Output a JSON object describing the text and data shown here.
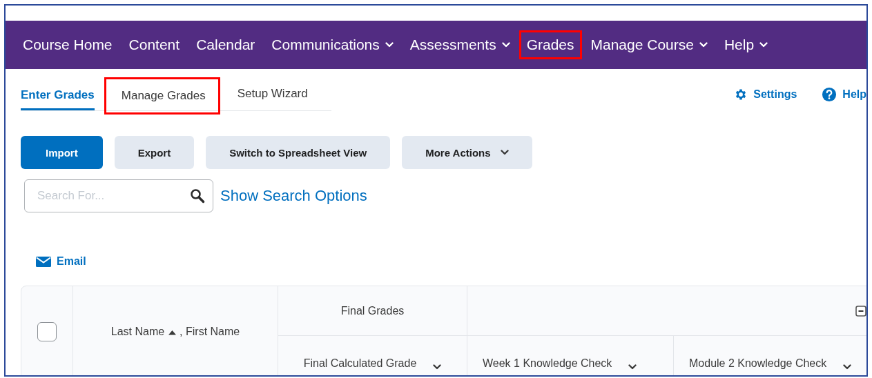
{
  "nav": {
    "items": [
      {
        "label": "Course Home",
        "dropdown": false,
        "highlighted": false
      },
      {
        "label": "Content",
        "dropdown": false,
        "highlighted": false
      },
      {
        "label": "Calendar",
        "dropdown": false,
        "highlighted": false
      },
      {
        "label": "Communications",
        "dropdown": true,
        "highlighted": false
      },
      {
        "label": "Assessments",
        "dropdown": true,
        "highlighted": false
      },
      {
        "label": "Grades",
        "dropdown": false,
        "highlighted": true
      },
      {
        "label": "Manage Course",
        "dropdown": true,
        "highlighted": false
      },
      {
        "label": "Help",
        "dropdown": true,
        "highlighted": false
      }
    ]
  },
  "tabs": [
    {
      "label": "Enter Grades",
      "selected": true,
      "highlighted": false
    },
    {
      "label": "Manage Grades",
      "selected": false,
      "highlighted": true
    },
    {
      "label": "Setup Wizard",
      "selected": false,
      "highlighted": false
    }
  ],
  "links": [
    {
      "kind": "settings",
      "label": "Settings"
    },
    {
      "kind": "help",
      "label": "Help"
    }
  ],
  "buttons": [
    {
      "label": "Import",
      "primary": true,
      "dropdown": false
    },
    {
      "label": "Export",
      "primary": false,
      "dropdown": false
    },
    {
      "label": "Switch to Spreadsheet View",
      "primary": false,
      "dropdown": false
    },
    {
      "label": "More Actions",
      "primary": false,
      "dropdown": true
    }
  ],
  "search": {
    "placeholder": "Search For...",
    "options_link": "Show Search Options"
  },
  "email_link": "Email",
  "table": {
    "select_all_checked": false,
    "name_column": {
      "last": "Last Name",
      "first": ", First Name"
    },
    "groups": [
      "Final Grades"
    ],
    "columns": [
      "Final Calculated Grade",
      "Week 1 Knowledge Check",
      "Module 2 Knowledge Check"
    ]
  }
}
